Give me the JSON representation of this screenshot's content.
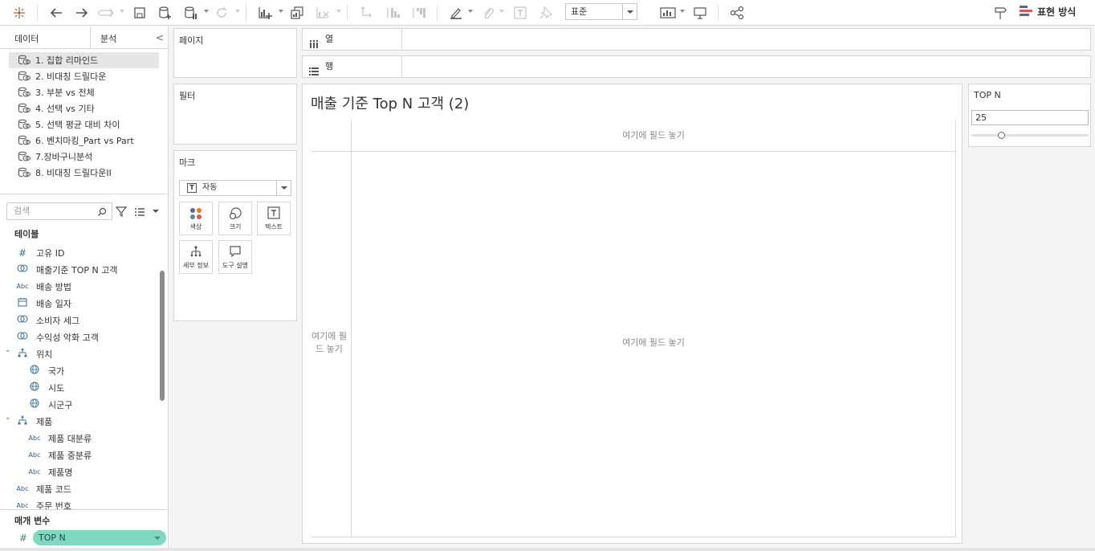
{
  "toolbar": {
    "format_select": "표준",
    "show_me_label": "표현 방식"
  },
  "data_pane": {
    "tab_data": "데이터",
    "tab_analytics": "분석",
    "datasources": [
      {
        "label": "1. 집합 리마인드",
        "selected": true
      },
      {
        "label": "2. 비대칭 드릴다운",
        "selected": false
      },
      {
        "label": "3. 부분 vs 전체",
        "selected": false
      },
      {
        "label": "4. 선택 vs 기타",
        "selected": false
      },
      {
        "label": "5. 선택 평균 대비 차이",
        "selected": false
      },
      {
        "label": "6. 벤치마킹_Part vs Part",
        "selected": false
      },
      {
        "label": "7.장바구니분석",
        "selected": false
      },
      {
        "label": "8. 비대칭 드릴다운II",
        "selected": false
      }
    ],
    "search_placeholder": "검색",
    "tables_title": "테이블",
    "fields": [
      {
        "label": "고유 ID",
        "type": "#",
        "indent": 0
      },
      {
        "label": "매출기준 TOP N 고객",
        "type": "set",
        "indent": 0
      },
      {
        "label": "배송 방법",
        "type": "Abc",
        "indent": 0
      },
      {
        "label": "배송 일자",
        "type": "date",
        "indent": 0
      },
      {
        "label": "소비자 세그",
        "type": "set",
        "indent": 0
      },
      {
        "label": "수익성 악화 고객",
        "type": "set",
        "indent": 0
      },
      {
        "label": "위치",
        "type": "hier",
        "indent": 0
      },
      {
        "label": "국가",
        "type": "geo",
        "indent": 1
      },
      {
        "label": "시도",
        "type": "geo",
        "indent": 1
      },
      {
        "label": "시군구",
        "type": "geo",
        "indent": 1
      },
      {
        "label": "제품",
        "type": "hier",
        "indent": 0
      },
      {
        "label": "제품 대분류",
        "type": "Abc",
        "indent": 1
      },
      {
        "label": "제품 중분류",
        "type": "Abc",
        "indent": 1
      },
      {
        "label": "제품명",
        "type": "Abc",
        "indent": 1
      },
      {
        "label": "제품 코드",
        "type": "Abc",
        "indent": 0
      },
      {
        "label": "주문 번호",
        "type": "Abc",
        "indent": 0
      }
    ],
    "params_title": "매개 변수",
    "param_pill": "TOP N"
  },
  "cards": {
    "pages": "페이지",
    "filters": "필터",
    "marks": "마크",
    "marks_type": "자동",
    "mark_buttons": [
      "색상",
      "크기",
      "텍스트",
      "세부 정보",
      "도구 설명"
    ]
  },
  "shelves": {
    "columns": "열",
    "rows": "행"
  },
  "viz": {
    "title": "매출 기준 Top N 고객 (2)",
    "drop_col": "여기에 필드 놓기",
    "drop_body": "여기에 필드 놓기",
    "drop_row": "여기에 필드 놓기"
  },
  "param_control": {
    "title": "TOP N",
    "value": "25",
    "slider_fraction": 0.25
  }
}
